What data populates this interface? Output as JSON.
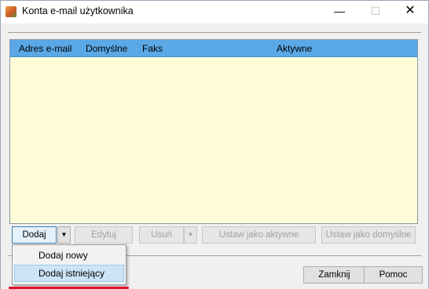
{
  "window": {
    "title": "Konta e-mail użytkownika",
    "controls": {
      "minimize": "—",
      "maximize": "☐",
      "close": "✕"
    }
  },
  "list": {
    "columns": [
      "Adres e-mail",
      "Domyślne",
      "Faks",
      "Aktywne"
    ],
    "rows": []
  },
  "toolbar": {
    "add_label": "Dodaj",
    "add_arrow": "▼",
    "edit_label": "Edytuj",
    "delete_label": "Usuń",
    "delete_arrow": "▼",
    "set_active_label": "Ustaw jako aktywne",
    "set_default_label": "Ustaw jako domyślne"
  },
  "add_menu": {
    "items": [
      "Dodaj nowy",
      "Dodaj istniejący"
    ],
    "highlighted": "Dodaj istniejący"
  },
  "footer": {
    "close_label": "Zamknij",
    "help_label": "Pomoc"
  },
  "colors": {
    "header_bg": "#5aa8e6",
    "list_bg": "#fffcd8",
    "highlight_underline": "#e0102a"
  }
}
